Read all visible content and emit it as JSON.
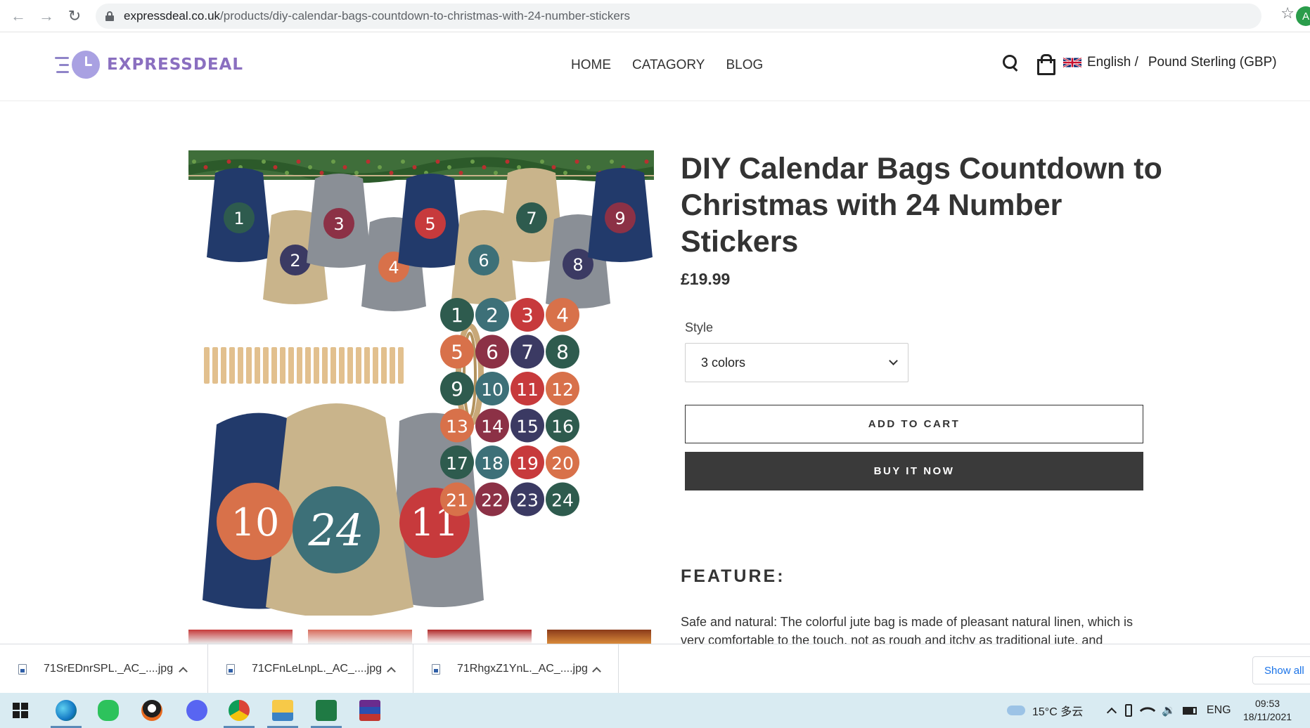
{
  "browser": {
    "url_host": "expressdeal.co.uk",
    "url_path": "/products/diy-calendar-bags-countdown-to-christmas-with-24-number-stickers",
    "profile_initial": "A"
  },
  "header": {
    "logo_text": "EXPRESSDEAL",
    "nav": [
      "HOME",
      "CATAGORY",
      "BLOG"
    ],
    "language": "English /",
    "currency": "Pound Sterling (GBP)"
  },
  "product": {
    "title": "DIY Calendar Bags Countdown to Christmas with 24 Number Stickers",
    "price": "£19.99",
    "style_label": "Style",
    "style_value": "3 colors",
    "add_to_cart": "ADD TO CART",
    "buy_now": "BUY IT NOW",
    "feature_heading": "FEATURE:",
    "feature_text": "Safe and natural: The colorful jute bag is made of pleasant natural linen, which is very comfortable to the touch, not as rough and itchy as traditional jute, and",
    "sticker_numbers": [
      "1",
      "2",
      "3",
      "4",
      "5",
      "6",
      "7",
      "8",
      "9",
      "10",
      "11",
      "12",
      "13",
      "14",
      "15",
      "16",
      "17",
      "18",
      "19",
      "20",
      "21",
      "22",
      "23",
      "24"
    ],
    "image_bag_numbers": [
      "1",
      "2",
      "3",
      "4",
      "5",
      "6",
      "7",
      "8",
      "9"
    ],
    "front_bag_numbers": [
      "10",
      "24",
      "11"
    ]
  },
  "downloads": {
    "items": [
      "71SrEDnrSPL._AC_....jpg",
      "71CFnLeLnpL._AC_....jpg",
      "71RhgxZ1YnL._AC_....jpg"
    ],
    "show_all": "Show all"
  },
  "taskbar": {
    "weather": "15°C 多云",
    "lang": "ENG",
    "time": "09:53",
    "date": "18/11/2021"
  },
  "colors": {
    "accent_logo": "#8a6fc0",
    "button_dark": "#3a3a3a",
    "sticker_green": "#2e5b4e",
    "sticker_navy": "#3b3a63",
    "sticker_maroon": "#8c3146",
    "sticker_orange": "#d8714a",
    "sticker_teal": "#3d7078",
    "sticker_red": "#c73a3c"
  }
}
